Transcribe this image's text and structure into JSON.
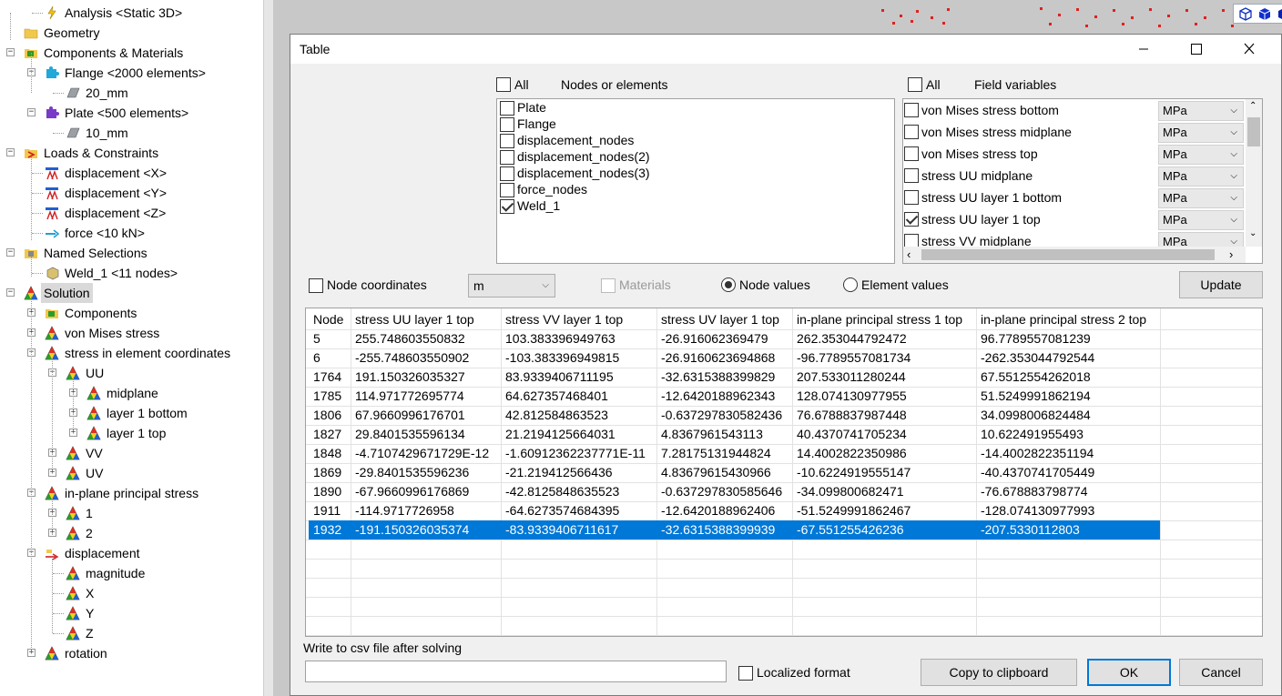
{
  "tree": {
    "items": [
      {
        "label": "Analysis <Static 3D>",
        "icon": "lightning-icon"
      },
      {
        "label": "Geometry",
        "icon": "folder-icon"
      },
      {
        "label": "Components & Materials",
        "icon": "components-icon"
      },
      {
        "label": "Flange <2000 elements>",
        "icon": "puzzle-cyan-icon"
      },
      {
        "label": "20_mm",
        "icon": "plate-icon"
      },
      {
        "label": "Plate <500 elements>",
        "icon": "puzzle-purple-icon"
      },
      {
        "label": "10_mm",
        "icon": "plate-icon"
      },
      {
        "label": "Loads & Constraints",
        "icon": "loads-icon"
      },
      {
        "label": "displacement <X>",
        "icon": "constraint-icon"
      },
      {
        "label": "displacement <Y>",
        "icon": "constraint-icon"
      },
      {
        "label": "displacement <Z>",
        "icon": "constraint-icon"
      },
      {
        "label": "force <10 kN>",
        "icon": "force-icon"
      },
      {
        "label": "Named Selections",
        "icon": "selections-icon"
      },
      {
        "label": "Weld_1 <11 nodes>",
        "icon": "selection-icon"
      },
      {
        "label": "Solution",
        "icon": "result-icon"
      },
      {
        "label": "Components",
        "icon": "components-icon"
      },
      {
        "label": "von Mises stress",
        "icon": "result-icon"
      },
      {
        "label": "stress in element coordinates",
        "icon": "result-icon"
      },
      {
        "label": "UU",
        "icon": "result-icon"
      },
      {
        "label": "midplane",
        "icon": "result-icon"
      },
      {
        "label": "layer 1 bottom",
        "icon": "result-icon"
      },
      {
        "label": "layer 1 top",
        "icon": "result-icon"
      },
      {
        "label": "VV",
        "icon": "result-icon"
      },
      {
        "label": "UV",
        "icon": "result-icon"
      },
      {
        "label": "in-plane principal stress",
        "icon": "result-icon"
      },
      {
        "label": "1",
        "icon": "result-icon"
      },
      {
        "label": "2",
        "icon": "result-icon"
      },
      {
        "label": "displacement",
        "icon": "displacement-icon"
      },
      {
        "label": "magnitude",
        "icon": "result-icon"
      },
      {
        "label": "X",
        "icon": "result-icon"
      },
      {
        "label": "Y",
        "icon": "result-icon"
      },
      {
        "label": "Z",
        "icon": "result-icon"
      },
      {
        "label": "rotation",
        "icon": "result-icon"
      }
    ]
  },
  "dialog": {
    "title": "Table",
    "nodes": {
      "all_label": "All",
      "header": "Nodes or elements",
      "items": [
        {
          "label": "Plate",
          "checked": false
        },
        {
          "label": "Flange",
          "checked": false
        },
        {
          "label": "displacement_nodes",
          "checked": false
        },
        {
          "label": "displacement_nodes(2)",
          "checked": false
        },
        {
          "label": "displacement_nodes(3)",
          "checked": false
        },
        {
          "label": "force_nodes",
          "checked": false
        },
        {
          "label": "Weld_1",
          "checked": true
        }
      ]
    },
    "fields": {
      "all_label": "All",
      "header": "Field variables",
      "items": [
        {
          "label": "von Mises stress bottom",
          "unit": "MPa",
          "checked": false
        },
        {
          "label": "von Mises stress midplane",
          "unit": "MPa",
          "checked": false
        },
        {
          "label": "von Mises stress top",
          "unit": "MPa",
          "checked": false
        },
        {
          "label": "stress UU midplane",
          "unit": "MPa",
          "checked": false
        },
        {
          "label": "stress UU layer 1 bottom",
          "unit": "MPa",
          "checked": false
        },
        {
          "label": "stress UU layer 1 top",
          "unit": "MPa",
          "checked": true
        },
        {
          "label": "stress VV midplane",
          "unit": "MPa",
          "checked": false
        }
      ]
    },
    "options": {
      "node_coordinates": "Node coordinates",
      "unit": "m",
      "materials": "Materials",
      "node_values": "Node values",
      "element_values": "Element values",
      "update": "Update"
    },
    "table": {
      "columns": [
        "Node",
        "stress UU layer 1 top",
        "stress VV layer 1 top",
        "stress UV layer 1 top",
        "in-plane principal stress 1 top",
        "in-plane principal stress 2 top"
      ],
      "rows": [
        [
          "5",
          "255.748603550832",
          "103.383396949763",
          "-26.916062369479",
          "262.353044792472",
          "96.7789557081239"
        ],
        [
          "6",
          "-255.748603550902",
          "-103.383396949815",
          "-26.9160623694868",
          "-96.7789557081734",
          "-262.353044792544"
        ],
        [
          "1764",
          "191.150326035327",
          "83.9339406711195",
          "-32.6315388399829",
          "207.533011280244",
          "67.5512554262018"
        ],
        [
          "1785",
          "114.971772695774",
          "64.627357468401",
          "-12.6420188962343",
          "128.074130977955",
          "51.5249991862194"
        ],
        [
          "1806",
          "67.9660996176701",
          "42.812584863523",
          "-0.637297830582436",
          "76.6788837987448",
          "34.0998006824484"
        ],
        [
          "1827",
          "29.8401535596134",
          "21.2194125664031",
          "4.8367961543113",
          "40.4370741705234",
          "10.622491955493"
        ],
        [
          "1848",
          "-4.7107429671729E-12",
          "-1.60912362237771E-11",
          "7.28175131944824",
          "14.4002822350986",
          "-14.4002822351194"
        ],
        [
          "1869",
          "-29.8401535596236",
          "-21.219412566436",
          "4.83679615430966",
          "-10.6224919555147",
          "-40.4370741705449"
        ],
        [
          "1890",
          "-67.9660996176869",
          "-42.8125848635523",
          "-0.637297830585646",
          "-34.09980068247​1",
          "-76.678883798774"
        ],
        [
          "1911",
          "-114.9717726958",
          "-64.6273574684395",
          "-12.6420188962406",
          "-51.5249991862467",
          "-128.074130977993"
        ],
        [
          "1932",
          "-191.150326035374",
          "-83.9339406711617",
          "-32.6315388399939",
          "-67.551255426236",
          "-207.5330112803"
        ]
      ],
      "selected_row": 10
    },
    "footer": {
      "csv_label": "Write to csv file after solving",
      "csv_value": "",
      "localized": "Localized format",
      "copy": "Copy to clipboard",
      "ok": "OK",
      "cancel": "Cancel"
    }
  },
  "colors": {
    "selection": "#0078d7",
    "canvas": "#c8c8c8",
    "dialog_bg": "#f0f0f0"
  }
}
